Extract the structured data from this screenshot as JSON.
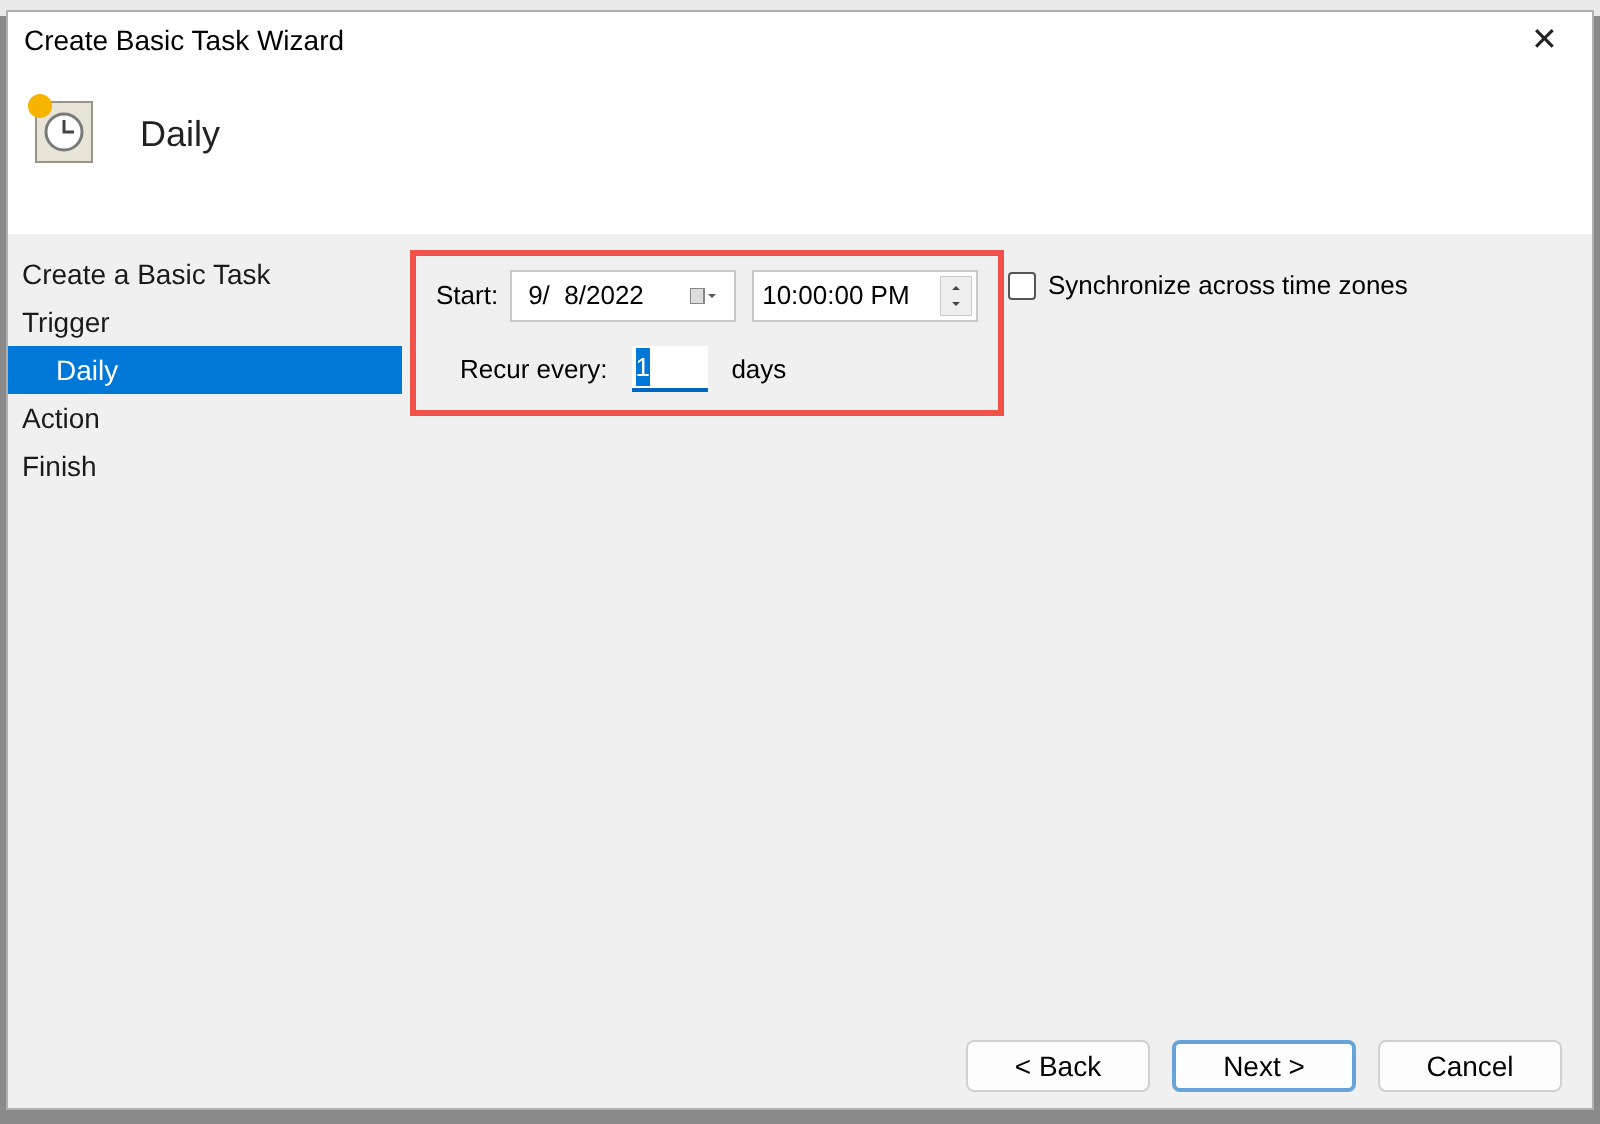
{
  "window": {
    "title": "Create Basic Task Wizard",
    "close": "✕"
  },
  "header": {
    "title": "Daily"
  },
  "steps": [
    {
      "label": "Create a Basic Task",
      "selected": false
    },
    {
      "label": "Trigger",
      "selected": false,
      "children": [
        {
          "label": "Daily",
          "selected": true
        }
      ]
    },
    {
      "label": "Action",
      "selected": false
    },
    {
      "label": "Finish",
      "selected": false
    }
  ],
  "form": {
    "start_label": "Start:",
    "date": "9/  8/2022",
    "time": "10:00:00 PM",
    "sync": {
      "label": "Synchronize across time zones",
      "checked": false
    },
    "recur_label": "Recur every:",
    "recur_value": "1",
    "recur_unit": "days",
    "highlighted": true
  },
  "buttons": [
    {
      "label": "< Back",
      "default": false
    },
    {
      "label": "Next >",
      "default": true
    },
    {
      "label": "Cancel",
      "default": false
    }
  ]
}
